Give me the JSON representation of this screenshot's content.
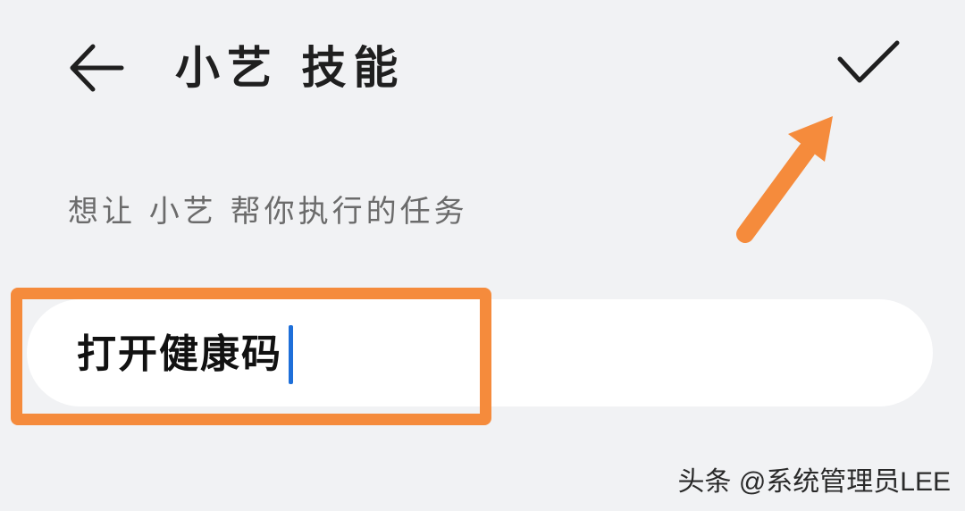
{
  "header": {
    "title": "小艺 技能",
    "back_icon": "arrow-left-icon",
    "confirm_icon": "checkmark-icon"
  },
  "form": {
    "label": "想让 小艺 帮你执行的任务",
    "input_value": "打开健康码"
  },
  "annotations": {
    "highlight_color": "#f58b3c",
    "arrow_color": "#f58b3c"
  },
  "watermark": {
    "text": "头条 @系统管理员LEE"
  }
}
